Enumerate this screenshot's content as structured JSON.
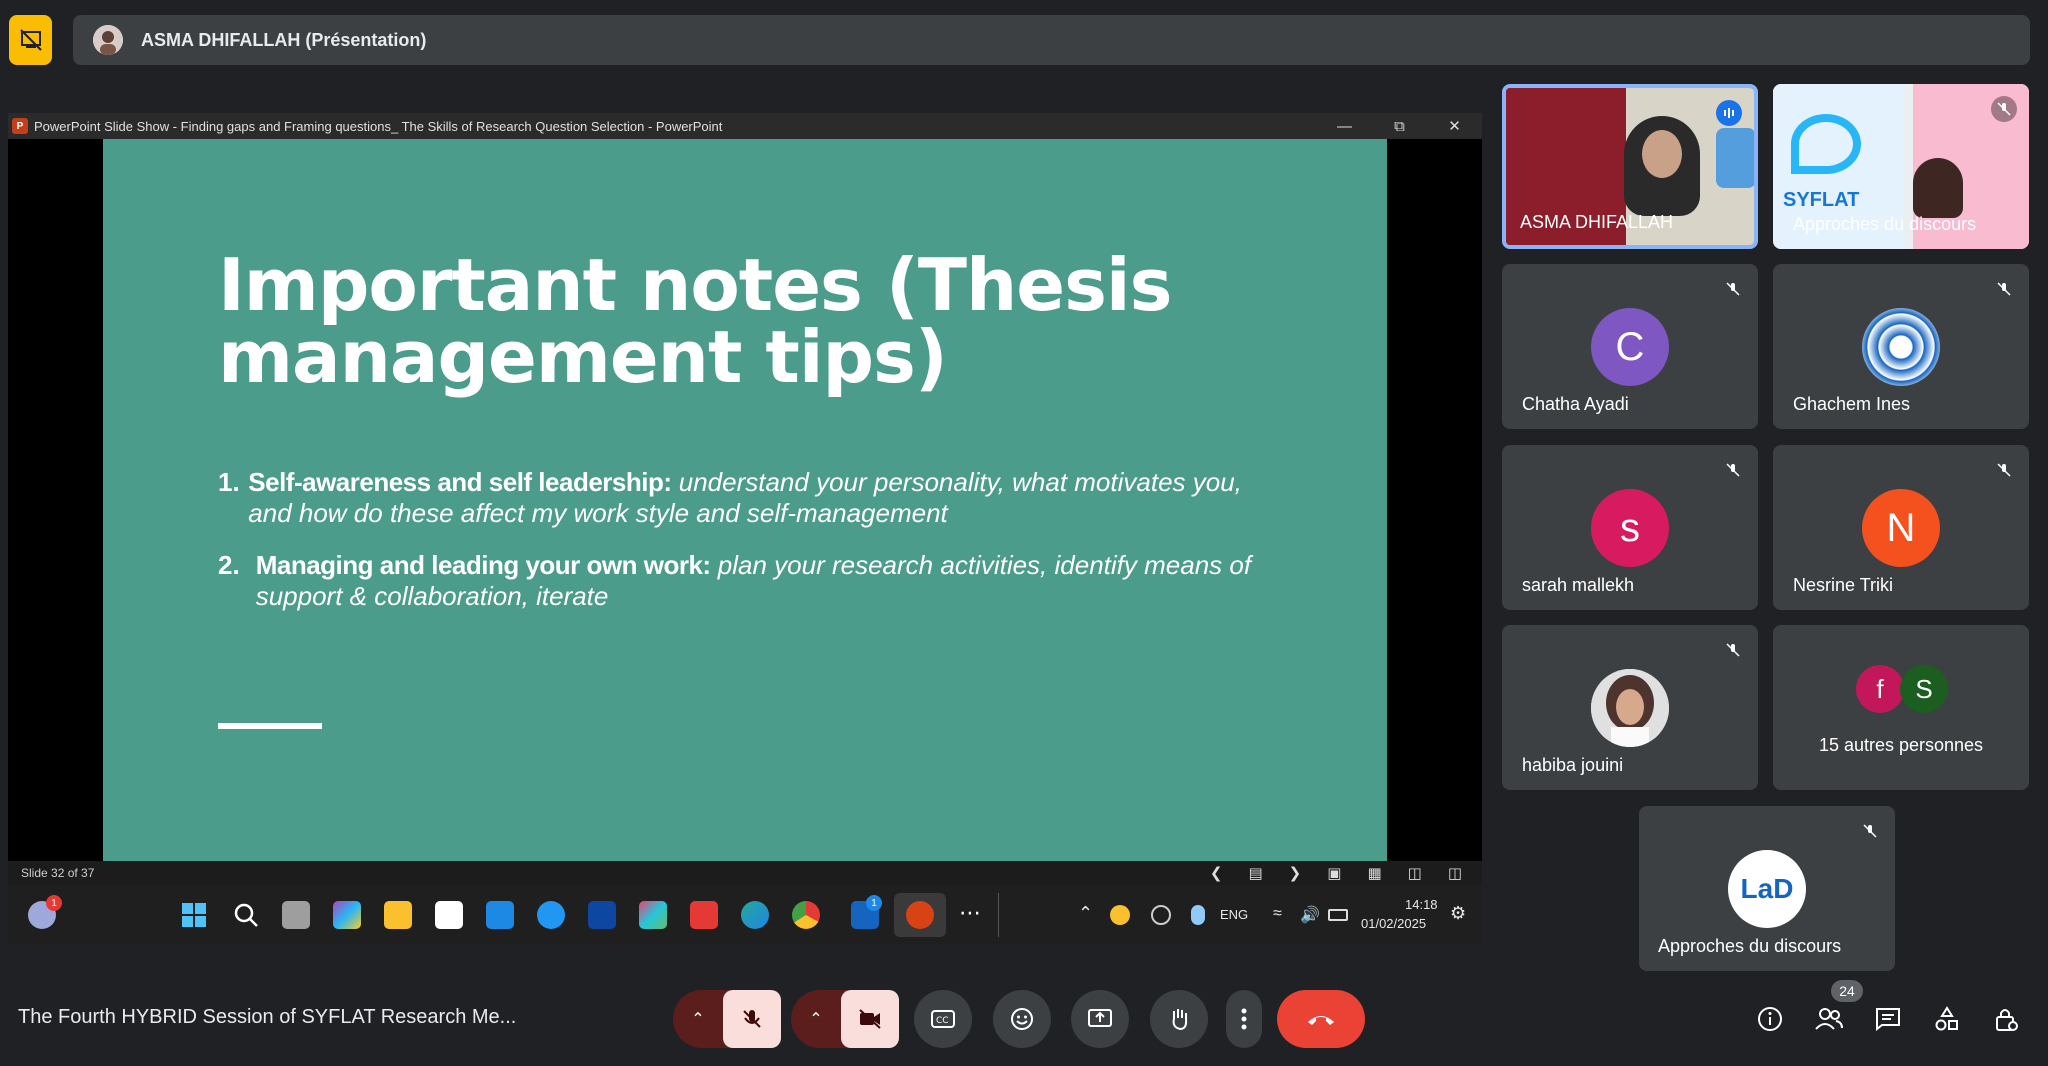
{
  "presenter": {
    "name": "ASMA DHIFALLAH (Présentation)"
  },
  "ppt": {
    "window_title": "PowerPoint Slide Show  -  Finding gaps and Framing questions_ The Skills of Research Question Selection - PowerPoint",
    "status": "Slide 32 of 37"
  },
  "slide": {
    "title_line1": "Important notes (Thesis",
    "title_line2": "management tips)",
    "items": [
      {
        "num": "1.",
        "bold": "Self-awareness and self leadership:",
        "italic": " understand your personality, what motivates you, and how do these affect my work style and self-management"
      },
      {
        "num": "2.",
        "bold": "Managing and leading your own work:",
        "italic": " plan your research activities, identify means of support & collaboration, iterate"
      }
    ]
  },
  "taskbar": {
    "weather_badge": "1",
    "outlook_badge": "1",
    "lang": "ENG",
    "time": "14:18",
    "date": "01/02/2025"
  },
  "participants": [
    {
      "name": "ASMA DHIFALLAH",
      "type": "video"
    },
    {
      "name": "Approches du discours",
      "type": "video"
    },
    {
      "name": "Chatha Ayadi",
      "initial": "C",
      "color": "#7e57c2"
    },
    {
      "name": "Ghachem Ines",
      "type": "pattern"
    },
    {
      "name": "sarah mallekh",
      "initial": "s",
      "color": "#d81b60"
    },
    {
      "name": "Nesrine Triki",
      "initial": "N",
      "color": "#f4511e"
    },
    {
      "name": "habiba jouini",
      "type": "photo"
    },
    {
      "name": "15 autres personnes",
      "initial_a": "f",
      "initial_b": "S"
    },
    {
      "name": "Approches du discours",
      "type": "logo",
      "logo_text": "LaD"
    }
  ],
  "meeting": {
    "title": "The Fourth HYBRID Session of SYFLAT Research Me...",
    "participant_count": "24"
  },
  "colors": {
    "accent_blue": "#8ab4f8",
    "end_call": "#ea4335",
    "slide_bg": "#4b9c8b"
  }
}
